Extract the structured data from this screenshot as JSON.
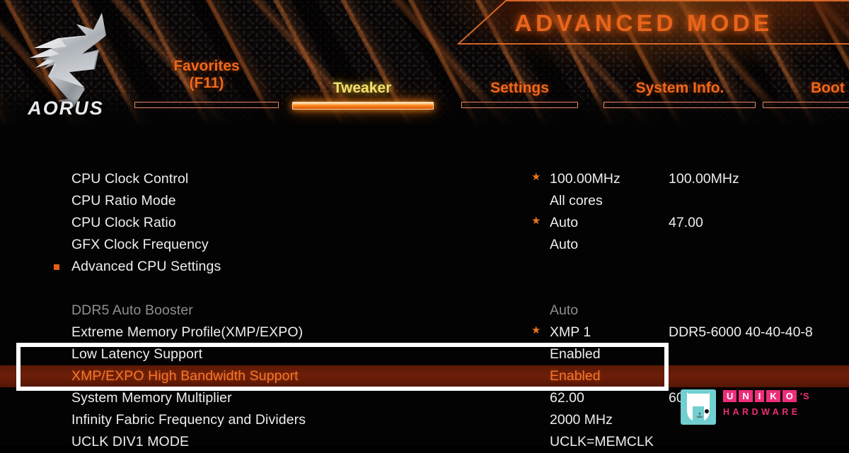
{
  "header": {
    "mode_title": "ADVANCED MODE",
    "brand_wordmark": "AORUS",
    "logo_icon": "aorus-eagle-icon",
    "accent_orange": "#f0681c",
    "accent_active_yellow": "#f5e36b",
    "selected_row_bg": "#6d1e08"
  },
  "nav": {
    "tabs": [
      {
        "label": "Favorites",
        "sublabel": "(F11)",
        "active": false
      },
      {
        "label": "Tweaker",
        "sublabel": "",
        "active": true
      },
      {
        "label": "Settings",
        "sublabel": "",
        "active": false
      },
      {
        "label": "System Info.",
        "sublabel": "",
        "active": false
      },
      {
        "label": "Boot",
        "sublabel": "",
        "active": false
      }
    ]
  },
  "settings": {
    "rows": [
      {
        "name": "CPU Clock Control",
        "star": "★",
        "value": "100.00MHz",
        "value2": "100.00MHz",
        "bullet": false,
        "dim": false,
        "selected": false
      },
      {
        "name": "CPU Ratio Mode",
        "star": "",
        "value": "All cores",
        "value2": "",
        "bullet": false,
        "dim": false,
        "selected": false
      },
      {
        "name": "CPU Clock Ratio",
        "star": "★",
        "value": "Auto",
        "value2": "47.00",
        "bullet": false,
        "dim": false,
        "selected": false
      },
      {
        "name": "GFX Clock Frequency",
        "star": "",
        "value": "Auto",
        "value2": "",
        "bullet": false,
        "dim": false,
        "selected": false
      },
      {
        "name": "Advanced CPU Settings",
        "star": "",
        "value": "",
        "value2": "",
        "bullet": true,
        "dim": false,
        "selected": false
      },
      {
        "name": "DDR5 Auto Booster",
        "star": "",
        "value": "Auto",
        "value2": "",
        "bullet": false,
        "dim": true,
        "selected": false
      },
      {
        "name": "Extreme Memory Profile(XMP/EXPO)",
        "star": "★",
        "value": "XMP 1",
        "value2": "DDR5-6000 40-40-40-8",
        "bullet": false,
        "dim": false,
        "selected": false
      },
      {
        "name": "Low Latency Support",
        "star": "",
        "value": "Enabled",
        "value2": "",
        "bullet": false,
        "dim": false,
        "selected": false
      },
      {
        "name": "XMP/EXPO High Bandwidth Support",
        "star": "",
        "value": "Enabled",
        "value2": "",
        "bullet": false,
        "dim": false,
        "selected": true
      },
      {
        "name": "System Memory Multiplier",
        "star": "",
        "value": "62.00",
        "value2": "60",
        "bullet": false,
        "dim": false,
        "selected": false
      },
      {
        "name": "Infinity Fabric Frequency and Dividers",
        "star": "",
        "value": "2000 MHz",
        "value2": "",
        "bullet": false,
        "dim": false,
        "selected": false
      },
      {
        "name": "UCLK DIV1 MODE",
        "star": "",
        "value": "UCLK=MEMCLK",
        "value2": "",
        "bullet": false,
        "dim": false,
        "selected": false
      }
    ]
  },
  "annotation": {
    "highlight_color": "#ffffff",
    "highlighted_rows": [
      "Low Latency Support",
      "XMP/EXPO High Bandwidth Support"
    ]
  },
  "watermark": {
    "icon": "uniko-bunny-icon",
    "letters": [
      "U",
      "N",
      "I",
      "K",
      "O"
    ],
    "apostrophe_s": "'S",
    "line2": "HARDWARE",
    "pink": "#ee2d7a",
    "teal": "#72cfcf"
  }
}
